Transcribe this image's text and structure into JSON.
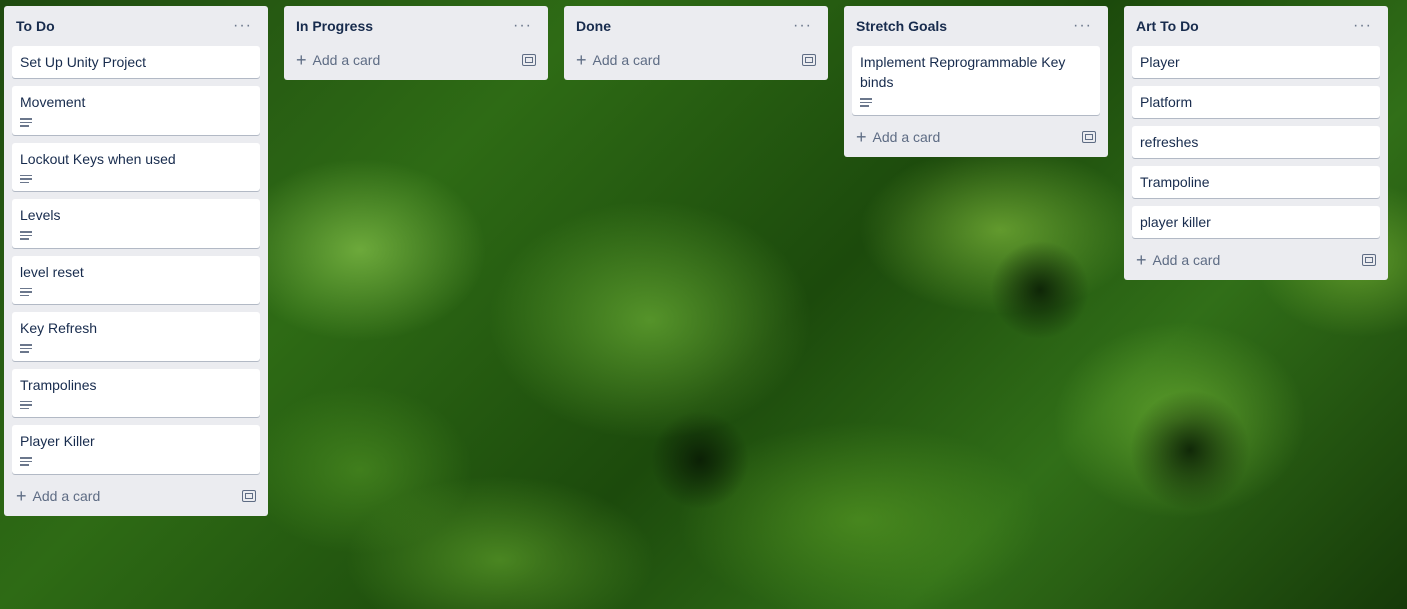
{
  "lists": [
    {
      "title": "To Do",
      "cards": [
        {
          "title": "Set Up Unity Project",
          "has_desc": false
        },
        {
          "title": "Movement",
          "has_desc": true
        },
        {
          "title": "Lockout Keys when used",
          "has_desc": true
        },
        {
          "title": "Levels",
          "has_desc": true
        },
        {
          "title": "level reset",
          "has_desc": true
        },
        {
          "title": "Key Refresh",
          "has_desc": true
        },
        {
          "title": "Trampolines",
          "has_desc": true
        },
        {
          "title": "Player Killer",
          "has_desc": true
        }
      ],
      "add_label": "Add a card"
    },
    {
      "title": "In Progress",
      "cards": [],
      "add_label": "Add a card"
    },
    {
      "title": "Done",
      "cards": [],
      "add_label": "Add a card"
    },
    {
      "title": "Stretch Goals",
      "cards": [
        {
          "title": "Implement Reprogrammable Key binds",
          "has_desc": true
        }
      ],
      "add_label": "Add a card"
    },
    {
      "title": "Art To Do",
      "cards": [
        {
          "title": "Player",
          "has_desc": false
        },
        {
          "title": "Platform",
          "has_desc": false
        },
        {
          "title": "refreshes",
          "has_desc": false
        },
        {
          "title": "Trampoline",
          "has_desc": false
        },
        {
          "title": "player killer",
          "has_desc": false
        }
      ],
      "add_label": "Add a card"
    }
  ],
  "icons": {
    "menu": "more-horizontal-icon",
    "add": "plus-icon",
    "template": "card-template-icon",
    "description": "description-icon"
  }
}
